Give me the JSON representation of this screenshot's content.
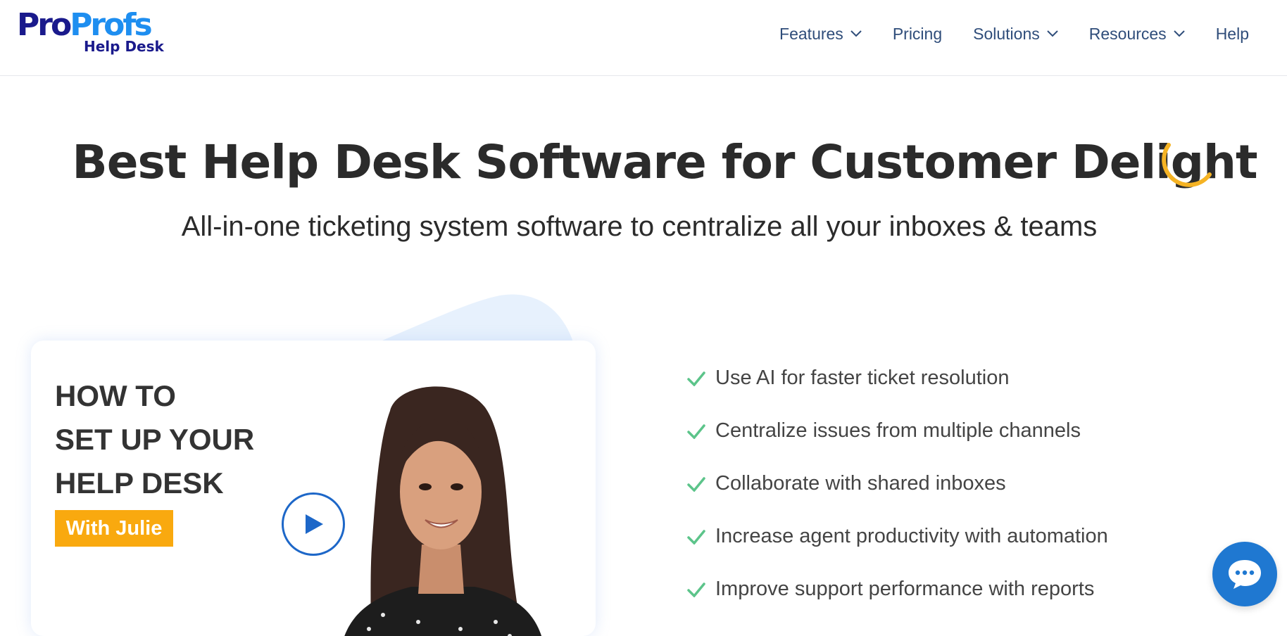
{
  "header": {
    "logo": {
      "word_a": "Pro",
      "word_b": "Profs",
      "subtitle": "Help Desk"
    },
    "nav": [
      {
        "label": "Features",
        "dropdown": true
      },
      {
        "label": "Pricing",
        "dropdown": false
      },
      {
        "label": "Solutions",
        "dropdown": true
      },
      {
        "label": "Resources",
        "dropdown": true
      },
      {
        "label": "Help",
        "dropdown": false
      }
    ]
  },
  "hero": {
    "title": "Best Help Desk Software for Customer Delight",
    "subtitle": "All-in-one ticketing system software to centralize all your inboxes & teams"
  },
  "video": {
    "heading_lines": [
      "HOW TO",
      "SET UP YOUR",
      "HELP DESK"
    ],
    "badge": "With Julie"
  },
  "features": [
    "Use AI for faster ticket resolution",
    "Centralize issues from multiple channels",
    "Collaborate with shared inboxes",
    "Increase agent productivity with automation",
    "Improve support performance with reports"
  ],
  "icons": {
    "chevron": "chevron-down-icon",
    "check": "check-icon",
    "play": "play-icon",
    "chat": "chat-bubble-icon",
    "loader": "loading-spinner-icon"
  },
  "colors": {
    "nav_text": "#2f4d7a",
    "logo_dark": "#1a1a8c",
    "logo_light": "#1e8ef0",
    "badge": "#f9a90f",
    "check": "#5cc48a",
    "play": "#1d67c8",
    "chat": "#1f78d1",
    "spinner": "#f5b324"
  }
}
